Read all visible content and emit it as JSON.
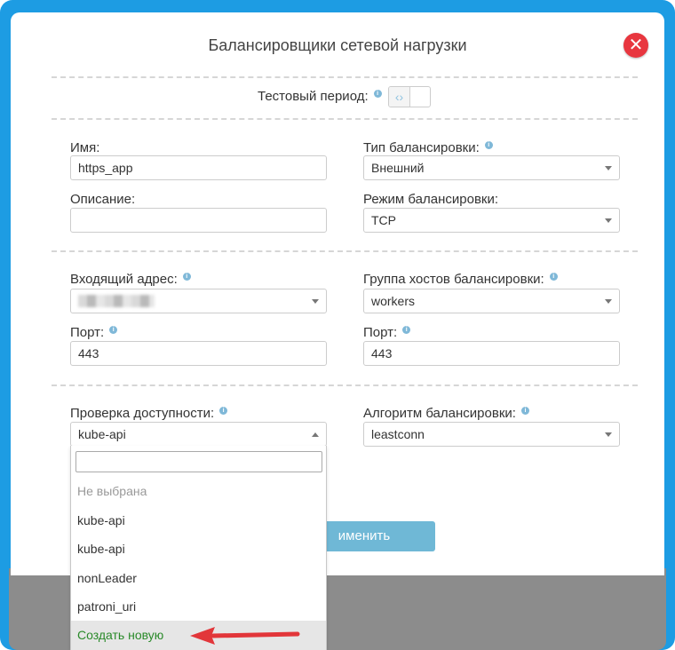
{
  "modal": {
    "title": "Балансировщики сетевой нагрузки",
    "close_label": "✕"
  },
  "test_period": {
    "label": "Тестовый период:",
    "toggle_glyph": "‹›"
  },
  "fields": {
    "name": {
      "label": "Имя:",
      "value": "https_app"
    },
    "description": {
      "label": "Описание:",
      "value": ""
    },
    "balance_type": {
      "label": "Тип балансировки:",
      "value": "Внешний"
    },
    "balance_mode": {
      "label": "Режим балансировки:",
      "value": "TCP"
    },
    "incoming_address": {
      "label": "Входящий адрес:",
      "value": ""
    },
    "host_group": {
      "label": "Группа хостов балансировки:",
      "value": "workers"
    },
    "port_left": {
      "label": "Порт:",
      "value": "443"
    },
    "port_right": {
      "label": "Порт:",
      "value": "443"
    },
    "health_check": {
      "label": "Проверка доступности:",
      "value": "kube-api"
    },
    "algorithm": {
      "label": "Алгоритм балансировки:",
      "value": "leastconn"
    }
  },
  "dropdown": {
    "search_value": "",
    "items": [
      {
        "label": "Не выбрана"
      },
      {
        "label": "kube-api"
      },
      {
        "label": "kube-api"
      },
      {
        "label": "nonLeader"
      },
      {
        "label": "patroni_uri"
      },
      {
        "label": "Создать новую"
      }
    ]
  },
  "apply_button": {
    "label": "именить"
  },
  "colors": {
    "accent": "#1d9ce3",
    "close": "#e8363f",
    "apply": "#6fb8d6",
    "create_item": "#2a8a2a",
    "arrow": "#e2363a"
  },
  "icons": {
    "info": "info-icon",
    "close": "close-icon",
    "caret": "chevron-down-icon"
  }
}
